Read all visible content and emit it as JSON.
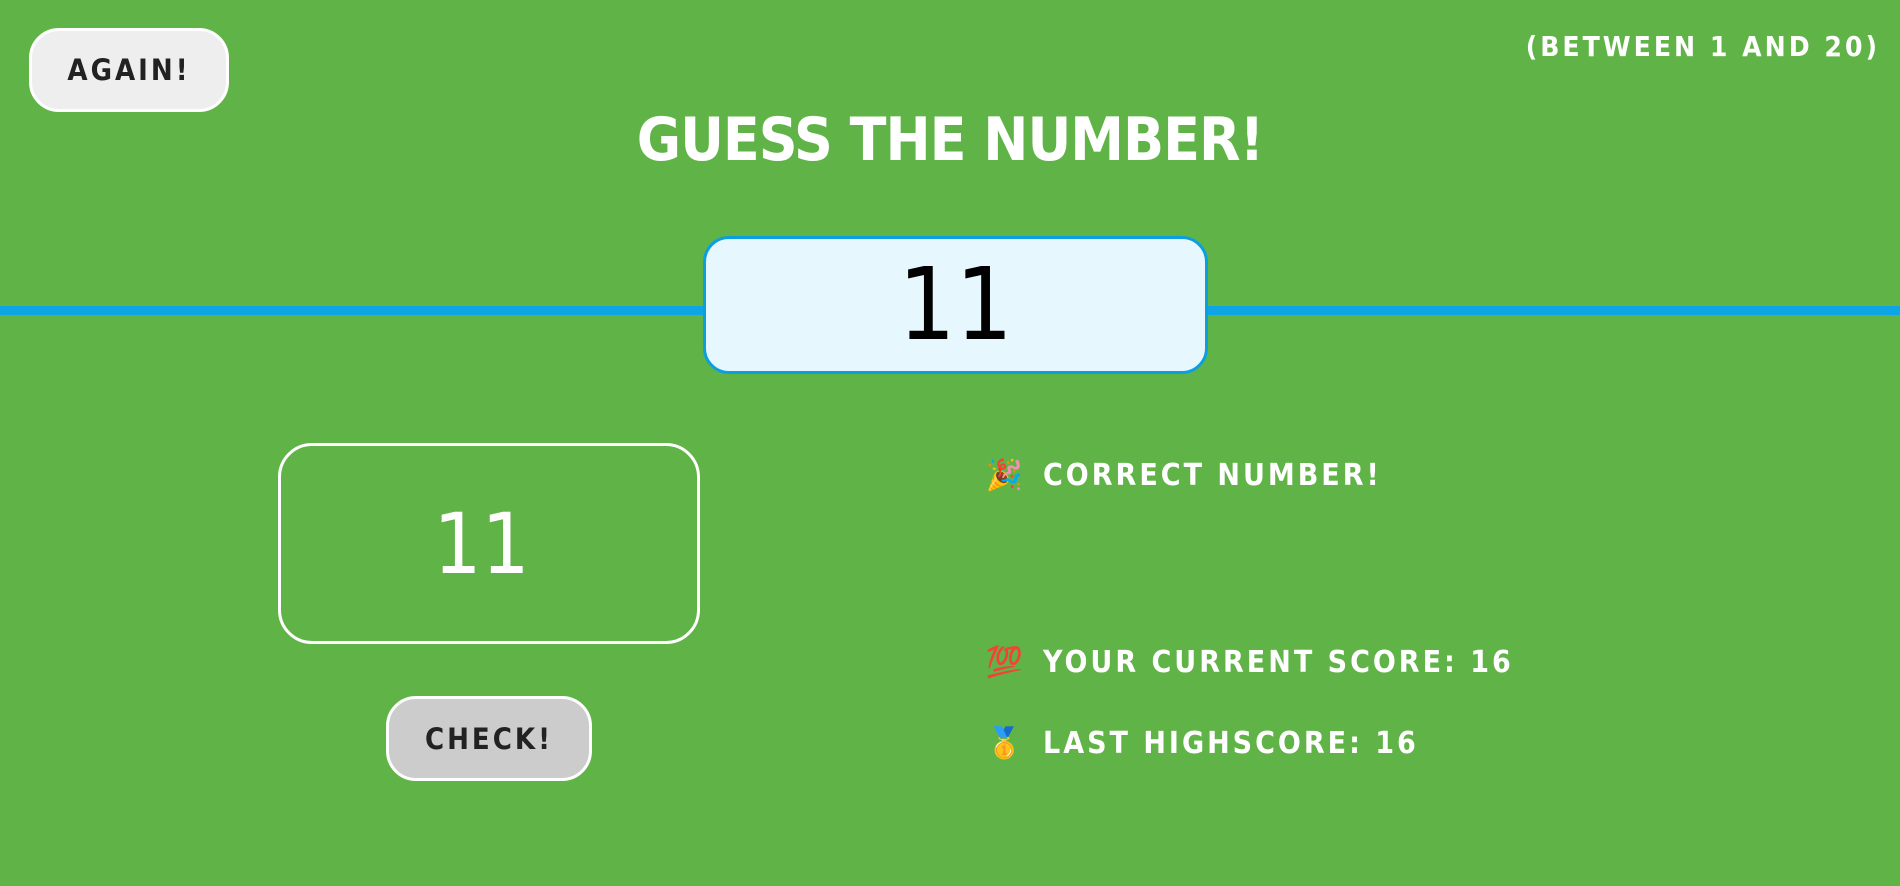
{
  "header": {
    "again_label": "AGAIN!",
    "range_text": "(BETWEEN 1 AND 20)",
    "title": "GUESS THE NUMBER!"
  },
  "secret_number": "11",
  "guess": {
    "value": "11"
  },
  "check_label": "CHECK!",
  "message": {
    "icon": "party-popper-icon",
    "emoji": "🎉",
    "text": "CORRECT NUMBER!"
  },
  "score": {
    "icon": "hundred-points-icon",
    "emoji": "💯",
    "text": "YOUR CURRENT SCORE: 16"
  },
  "highscore": {
    "icon": "medal-icon",
    "emoji": "🥇",
    "text": "LAST HIGHSCORE: 16"
  },
  "colors": {
    "background": "#60b347",
    "accent_blue": "#0da5e6",
    "number_box_bg": "#e6f8fd",
    "again_button_bg": "#eeeeee",
    "check_button_bg": "#cccccc"
  }
}
